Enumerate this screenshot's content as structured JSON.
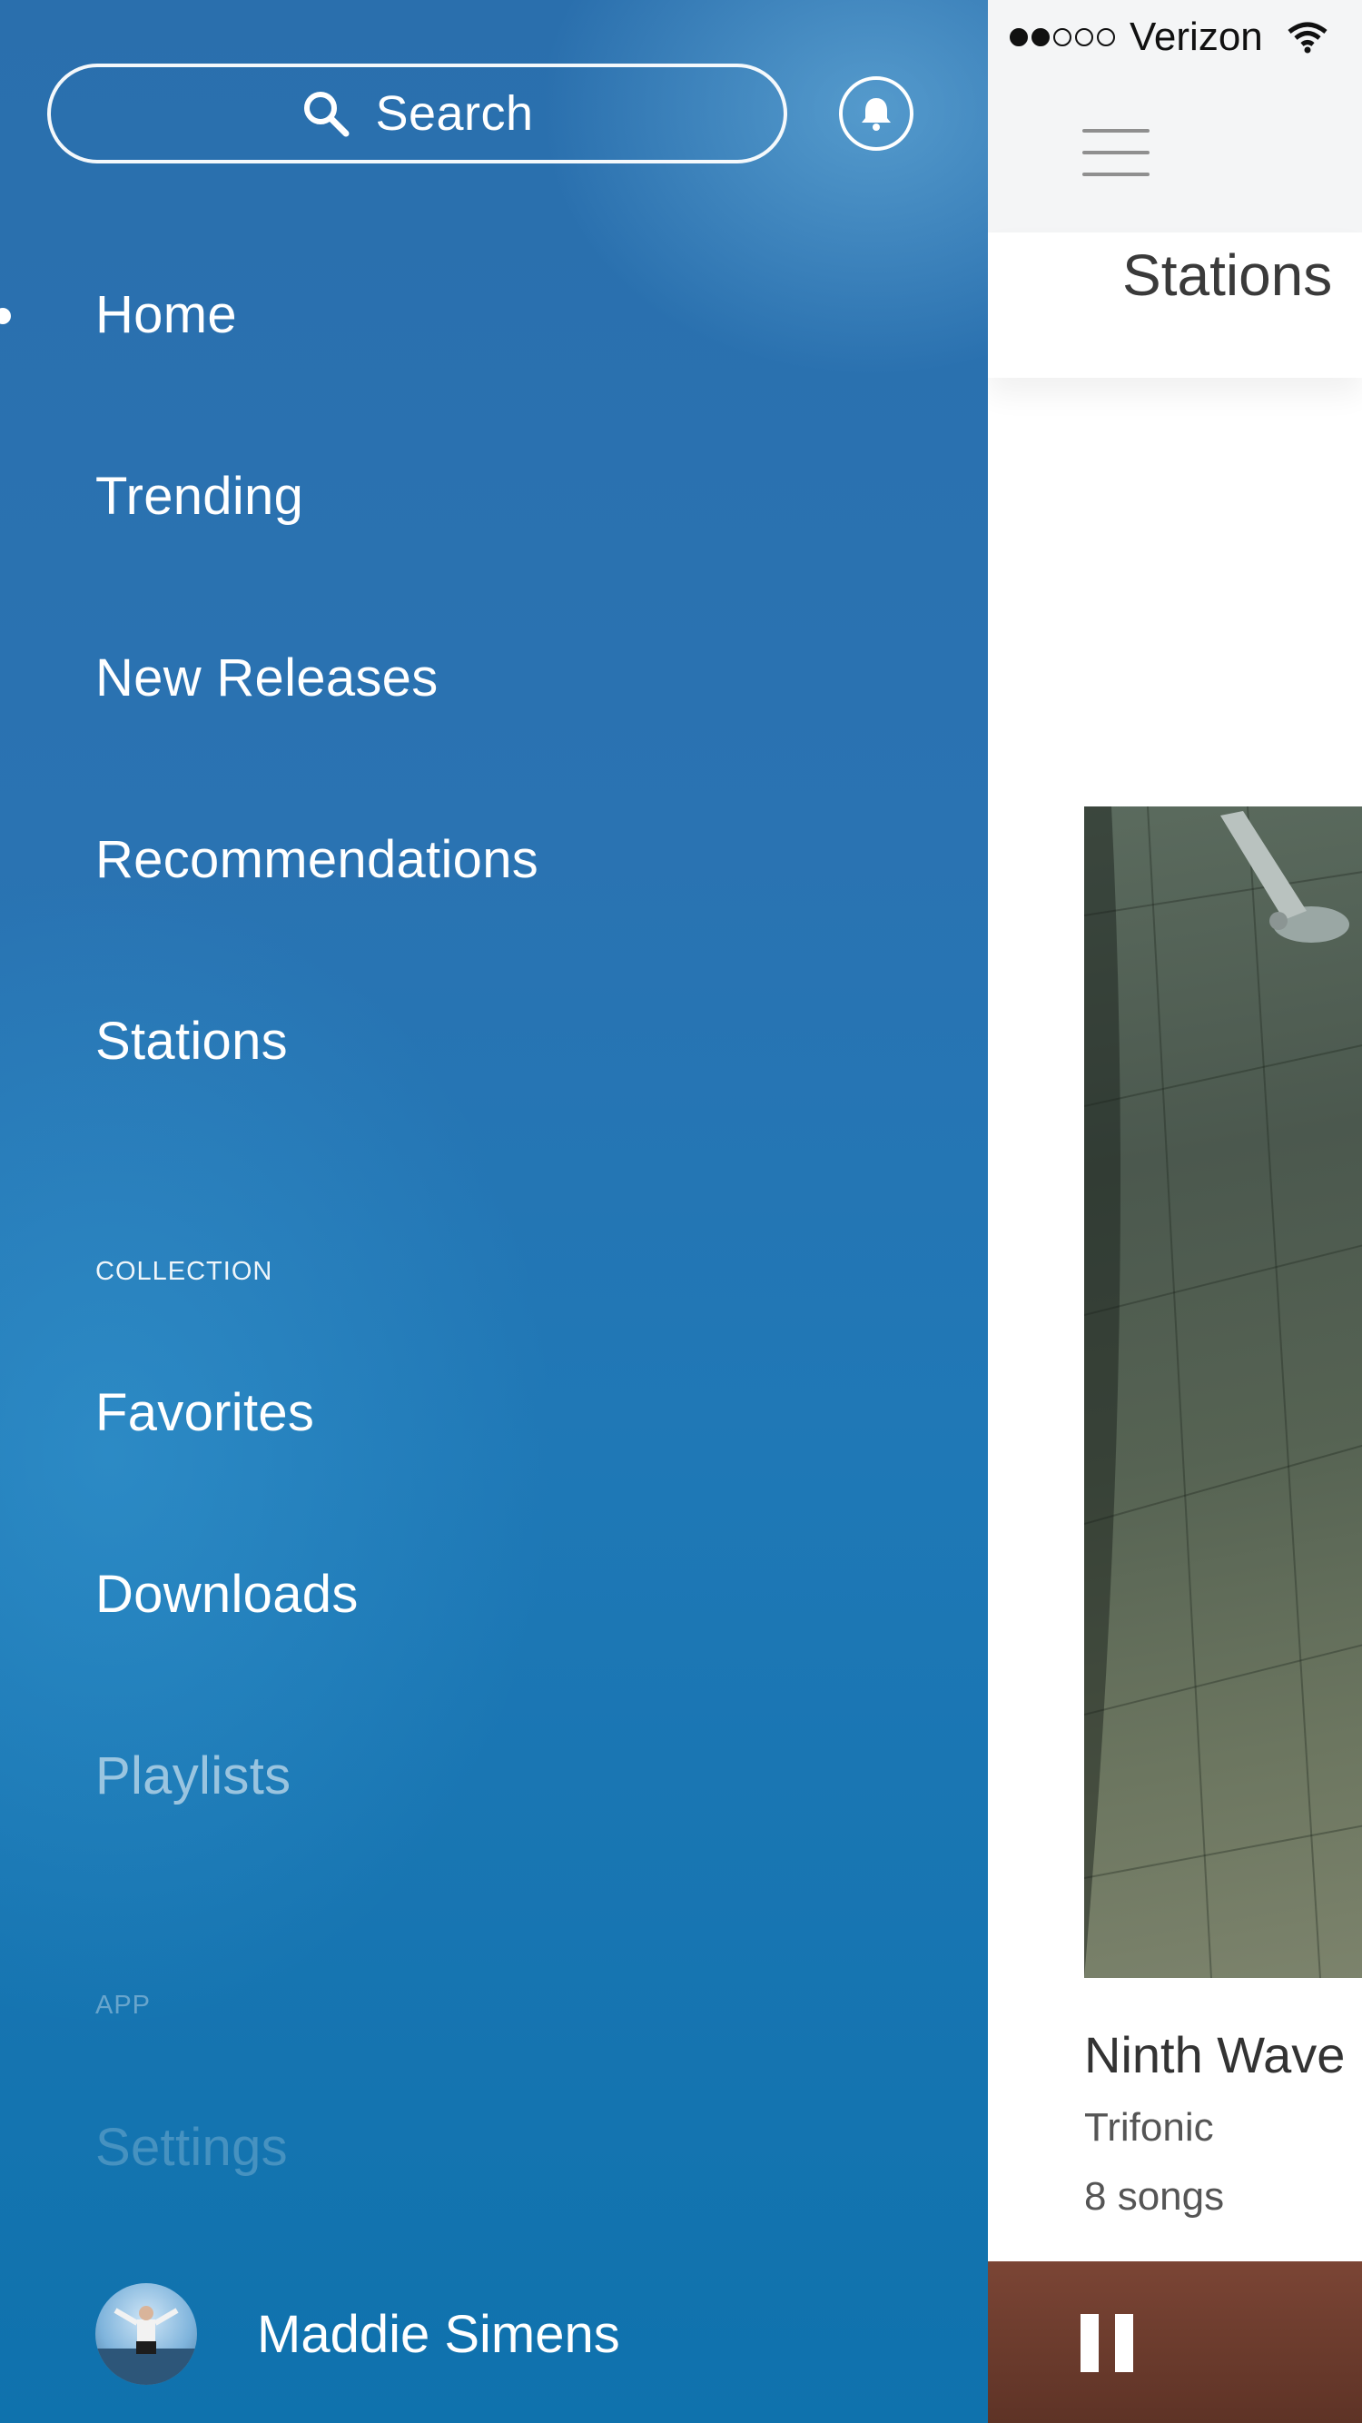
{
  "drawer": {
    "search_label": "Search",
    "nav": [
      {
        "label": "Home",
        "active": true
      },
      {
        "label": "Trending"
      },
      {
        "label": "New Releases"
      },
      {
        "label": "Recommendations"
      },
      {
        "label": "Stations"
      }
    ],
    "collection_label": "COLLECTION",
    "collection": [
      {
        "label": "Favorites"
      },
      {
        "label": "Downloads"
      },
      {
        "label": "Playlists"
      }
    ],
    "app_label": "APP",
    "app": [
      {
        "label": "Settings"
      }
    ],
    "user_name": "Maddie Simens"
  },
  "status_bar": {
    "carrier": "Verizon",
    "signal_bars_filled": 2,
    "signal_bars_total": 5
  },
  "main": {
    "section_title": "Stations",
    "album": {
      "title": "Ninth Wave",
      "artist": "Trifonic",
      "song_count": "8 songs"
    }
  },
  "colors": {
    "drawer_blue": "#1f78b6",
    "player_brown": "#6d3c2e",
    "navbar_bg": "#f4f5f6"
  },
  "icons": [
    "search-icon",
    "bell-icon",
    "wifi-icon",
    "hamburger-icon",
    "pause-icon"
  ]
}
